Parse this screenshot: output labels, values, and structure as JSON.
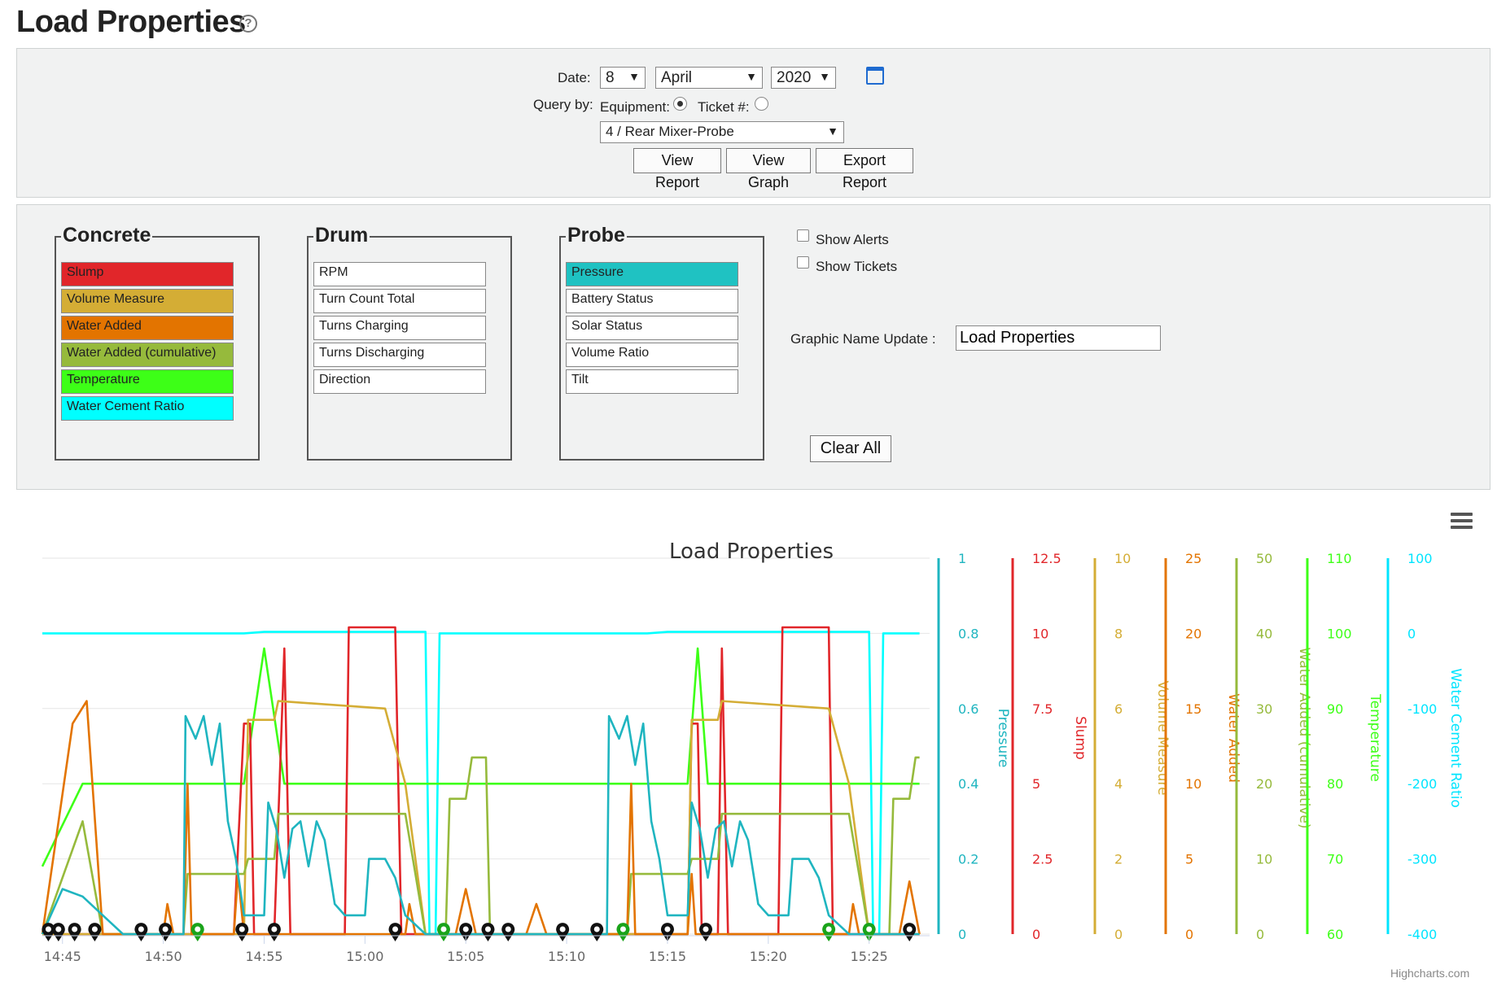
{
  "page": {
    "title": "Load Properties",
    "help_icon": "question-circle-icon"
  },
  "query": {
    "date_label": "Date:",
    "day": "8",
    "month": "April",
    "year": "2020",
    "calendar_icon": "calendar-icon",
    "query_by_label": "Query by:",
    "equipment_label": "Equipment:",
    "ticket_label": "Ticket #:",
    "equipment_selected": true,
    "equipment_value": "4 / Rear Mixer-Probe",
    "buttons": {
      "view_report": "View Report",
      "view_graph": "View Graph",
      "export_report": "Export Report"
    }
  },
  "groups": {
    "concrete": {
      "title": "Concrete",
      "items": [
        {
          "label": "Slump",
          "color": "#e1262a"
        },
        {
          "label": "Volume Measure",
          "color": "#d4ad35"
        },
        {
          "label": "Water Added",
          "color": "#e37400"
        },
        {
          "label": "Water Added (cumulative)",
          "color": "#96ba3c"
        },
        {
          "label": "Temperature",
          "color": "#3dff17"
        },
        {
          "label": "Water Cement Ratio",
          "color": "#00ffff"
        }
      ]
    },
    "drum": {
      "title": "Drum",
      "items": [
        {
          "label": "RPM"
        },
        {
          "label": "Turn Count Total"
        },
        {
          "label": "Turns Charging"
        },
        {
          "label": "Turns Discharging"
        },
        {
          "label": "Direction"
        }
      ]
    },
    "probe": {
      "title": "Probe",
      "items": [
        {
          "label": "Pressure",
          "color": "#1fc2c2"
        },
        {
          "label": "Battery Status"
        },
        {
          "label": "Solar Status"
        },
        {
          "label": "Volume Ratio"
        },
        {
          "label": "Tilt"
        }
      ]
    }
  },
  "options": {
    "show_alerts": "Show Alerts",
    "show_tickets": "Show Tickets",
    "graphic_name_label": "Graphic Name Update :",
    "graphic_name_value": "Load Properties",
    "clear_all": "Clear All"
  },
  "chart_data": {
    "type": "line",
    "title": "Load Properties",
    "x_ticks": [
      "14:45",
      "14:50",
      "14:55",
      "15:00",
      "15:05",
      "15:10",
      "15:15",
      "15:20",
      "15:25"
    ],
    "x_range": [
      "14:44",
      "15:28"
    ],
    "grid": true,
    "credit": "Highcharts.com",
    "menu_icon": "hamburger-menu-icon",
    "y_axes": [
      {
        "title": "Pressure",
        "color": "#1fb5c0",
        "range": [
          0,
          1
        ],
        "ticks": [
          "0",
          "0.2",
          "0.4",
          "0.6",
          "0.8",
          "1"
        ]
      },
      {
        "title": "Slump",
        "color": "#e1262a",
        "range": [
          0,
          12.5
        ],
        "ticks": [
          "0",
          "2.5",
          "5",
          "7.5",
          "10",
          "12.5"
        ]
      },
      {
        "title": "Volume Measure",
        "color": "#d4ad35",
        "range": [
          0,
          10
        ],
        "ticks": [
          "0",
          "2",
          "4",
          "6",
          "8",
          "10"
        ]
      },
      {
        "title": "Water Added",
        "color": "#e37400",
        "range": [
          0,
          25
        ],
        "ticks": [
          "0",
          "5",
          "10",
          "15",
          "20",
          "25"
        ]
      },
      {
        "title": "Water Added (cumulative)",
        "color": "#96ba3c",
        "range": [
          0,
          50
        ],
        "ticks": [
          "0",
          "10",
          "20",
          "30",
          "40",
          "50"
        ]
      },
      {
        "title": "Temperature",
        "color": "#3dff17",
        "range": [
          60,
          110
        ],
        "ticks": [
          "60",
          "70",
          "80",
          "90",
          "100",
          "110"
        ]
      },
      {
        "title": "Water Cement Ratio",
        "color": "#00e5ff",
        "range": [
          -400,
          100
        ],
        "ticks": [
          "-400",
          "-300",
          "-200",
          "-100",
          "0",
          "100"
        ]
      }
    ],
    "series": [
      {
        "name": "Water Cement Ratio",
        "color": "#00ffff",
        "axis": 6,
        "points": [
          [
            "14:44",
            0
          ],
          [
            "14:54",
            0
          ],
          [
            "14:55",
            2
          ],
          [
            "15:03",
            2
          ],
          [
            "15:03.2",
            -400
          ],
          [
            "15:03.5",
            -400
          ],
          [
            "15:03.7",
            0
          ],
          [
            "15:14",
            0
          ],
          [
            "15:15",
            2
          ],
          [
            "15:25",
            2
          ],
          [
            "15:25.2",
            -400
          ],
          [
            "15:25.5",
            -400
          ],
          [
            "15:25.7",
            0
          ],
          [
            "15:27.5",
            0
          ]
        ]
      },
      {
        "name": "Temperature",
        "color": "#3dff17",
        "axis": 5,
        "points": [
          [
            "14:44",
            69
          ],
          [
            "14:46",
            80
          ],
          [
            "14:54",
            80
          ],
          [
            "14:55",
            98
          ],
          [
            "14:56",
            80
          ],
          [
            "15:16",
            80
          ],
          [
            "15:16.5",
            98
          ],
          [
            "15:17",
            80
          ],
          [
            "15:27.5",
            80
          ]
        ]
      },
      {
        "name": "Slump",
        "color": "#e1262a",
        "axis": 1,
        "points": [
          [
            "14:44",
            0
          ],
          [
            "14:53.5",
            0
          ],
          [
            "14:54",
            7
          ],
          [
            "14:54.3",
            7
          ],
          [
            "14:54.5",
            0
          ],
          [
            "14:55.5",
            0
          ],
          [
            "14:56",
            9.5
          ],
          [
            "14:56.3",
            0
          ],
          [
            "14:59",
            0
          ],
          [
            "14:59.2",
            10.2
          ],
          [
            "15:01.5",
            10.2
          ],
          [
            "15:01.8",
            0
          ],
          [
            "15:16",
            0
          ],
          [
            "15:16.2",
            7
          ],
          [
            "15:16.5",
            7
          ],
          [
            "15:16.7",
            0
          ],
          [
            "15:17.5",
            0
          ],
          [
            "15:17.7",
            9.5
          ],
          [
            "15:18",
            0
          ],
          [
            "15:20.5",
            0
          ],
          [
            "15:20.7",
            10.2
          ],
          [
            "15:23",
            10.2
          ],
          [
            "15:23.2",
            0
          ],
          [
            "15:27.5",
            0
          ]
        ]
      },
      {
        "name": "Volume Measure",
        "color": "#d4ad35",
        "axis": 2,
        "points": [
          [
            "14:44",
            0
          ],
          [
            "14:54",
            0
          ],
          [
            "14:54.2",
            5.7
          ],
          [
            "14:55.5",
            5.7
          ],
          [
            "14:55.7",
            6.2
          ],
          [
            "15:01",
            6
          ],
          [
            "15:02",
            4
          ],
          [
            "15:03",
            0
          ],
          [
            "15:16",
            0
          ],
          [
            "15:16.2",
            5.7
          ],
          [
            "15:17.5",
            5.7
          ],
          [
            "15:17.7",
            6.2
          ],
          [
            "15:23",
            6
          ],
          [
            "15:24",
            4
          ],
          [
            "15:25",
            0
          ],
          [
            "15:27.5",
            0
          ]
        ]
      },
      {
        "name": "Water Added (cumulative)",
        "color": "#96ba3c",
        "axis": 4,
        "points": [
          [
            "14:44",
            0
          ],
          [
            "14:46",
            15
          ],
          [
            "14:47",
            0
          ],
          [
            "14:51",
            0
          ],
          [
            "14:51.2",
            8
          ],
          [
            "14:54",
            8
          ],
          [
            "14:54.2",
            10
          ],
          [
            "14:55.5",
            10
          ],
          [
            "14:55.7",
            16
          ],
          [
            "15:02",
            16
          ],
          [
            "15:03",
            0
          ],
          [
            "15:04",
            0
          ],
          [
            "15:04.2",
            18
          ],
          [
            "15:05",
            18
          ],
          [
            "15:05.3",
            23.5
          ],
          [
            "15:06",
            23.5
          ],
          [
            "15:06.2",
            0
          ],
          [
            "15:13",
            0
          ],
          [
            "15:13.2",
            8
          ],
          [
            "15:16",
            8
          ],
          [
            "15:16.2",
            10
          ],
          [
            "15:17.5",
            10
          ],
          [
            "15:17.7",
            16
          ],
          [
            "15:24",
            16
          ],
          [
            "15:25",
            0
          ],
          [
            "15:26",
            0
          ],
          [
            "15:26.2",
            18
          ],
          [
            "15:27",
            18
          ],
          [
            "15:27.3",
            23.5
          ],
          [
            "15:27.5",
            23.5
          ]
        ]
      },
      {
        "name": "Water Added",
        "color": "#e37400",
        "axis": 3,
        "points": [
          [
            "14:44",
            0
          ],
          [
            "14:45.5",
            14
          ],
          [
            "14:46.2",
            15.5
          ],
          [
            "14:47",
            0
          ],
          [
            "14:50",
            0
          ],
          [
            "14:50.2",
            2
          ],
          [
            "14:50.5",
            0
          ],
          [
            "14:51",
            0
          ],
          [
            "14:51.2",
            10
          ],
          [
            "14:51.4",
            0
          ],
          [
            "14:53.5",
            0
          ],
          [
            "14:53.7",
            4
          ],
          [
            "14:54",
            0
          ],
          [
            "15:02",
            0
          ],
          [
            "15:02.2",
            2
          ],
          [
            "15:02.5",
            0
          ],
          [
            "15:04.5",
            0
          ],
          [
            "15:05",
            3
          ],
          [
            "15:05.5",
            0
          ],
          [
            "15:08",
            0
          ],
          [
            "15:08.5",
            2
          ],
          [
            "15:09",
            0
          ],
          [
            "15:13",
            0
          ],
          [
            "15:13.2",
            10
          ],
          [
            "15:13.4",
            0
          ],
          [
            "15:16",
            0
          ],
          [
            "15:16.2",
            4
          ],
          [
            "15:16.4",
            0
          ],
          [
            "15:24",
            0
          ],
          [
            "15:24.2",
            2
          ],
          [
            "15:24.5",
            0
          ],
          [
            "15:26.5",
            0
          ],
          [
            "15:27",
            3.5
          ],
          [
            "15:27.5",
            0
          ]
        ]
      },
      {
        "name": "Pressure",
        "color": "#1fb5c0",
        "axis": 0,
        "points": [
          [
            "14:44",
            0
          ],
          [
            "14:45",
            0.12
          ],
          [
            "14:46",
            0.1
          ],
          [
            "14:47",
            0.05
          ],
          [
            "14:48",
            0
          ],
          [
            "14:51",
            0
          ],
          [
            "14:51.1",
            0.58
          ],
          [
            "14:51.6",
            0.52
          ],
          [
            "14:52",
            0.58
          ],
          [
            "14:52.4",
            0.45
          ],
          [
            "14:52.8",
            0.56
          ],
          [
            "14:53.2",
            0.3
          ],
          [
            "14:53.6",
            0.2
          ],
          [
            "14:54",
            0.05
          ],
          [
            "14:55",
            0.05
          ],
          [
            "14:55.2",
            0.35
          ],
          [
            "14:55.6",
            0.28
          ],
          [
            "14:56",
            0.15
          ],
          [
            "14:56.4",
            0.28
          ],
          [
            "14:56.8",
            0.3
          ],
          [
            "14:57.2",
            0.18
          ],
          [
            "14:57.6",
            0.3
          ],
          [
            "14:58",
            0.25
          ],
          [
            "14:58.5",
            0.08
          ],
          [
            "14:59",
            0.05
          ],
          [
            "15:00",
            0.05
          ],
          [
            "15:00.2",
            0.2
          ],
          [
            "15:01",
            0.2
          ],
          [
            "15:01.5",
            0.15
          ],
          [
            "15:02",
            0.05
          ],
          [
            "15:03",
            0
          ],
          [
            "15:12",
            0
          ],
          [
            "15:12.1",
            0.58
          ],
          [
            "15:12.6",
            0.52
          ],
          [
            "15:13",
            0.58
          ],
          [
            "15:13.4",
            0.45
          ],
          [
            "15:13.8",
            0.56
          ],
          [
            "15:14.2",
            0.3
          ],
          [
            "15:14.6",
            0.2
          ],
          [
            "15:15",
            0.05
          ],
          [
            "15:16",
            0.05
          ],
          [
            "15:16.2",
            0.35
          ],
          [
            "15:16.6",
            0.28
          ],
          [
            "15:17",
            0.15
          ],
          [
            "15:17.4",
            0.28
          ],
          [
            "15:17.8",
            0.3
          ],
          [
            "15:18.2",
            0.18
          ],
          [
            "15:18.6",
            0.3
          ],
          [
            "15:19",
            0.25
          ],
          [
            "15:19.5",
            0.08
          ],
          [
            "15:20",
            0.05
          ],
          [
            "15:21",
            0.05
          ],
          [
            "15:21.2",
            0.2
          ],
          [
            "15:22",
            0.2
          ],
          [
            "15:22.5",
            0.15
          ],
          [
            "15:23",
            0.05
          ],
          [
            "15:24",
            0
          ],
          [
            "15:27.5",
            0
          ]
        ]
      }
    ],
    "markers": [
      {
        "time": "14:44.3",
        "color": "black"
      },
      {
        "time": "14:44.8",
        "color": "black"
      },
      {
        "time": "14:45.6",
        "color": "black"
      },
      {
        "time": "14:46.6",
        "color": "black"
      },
      {
        "time": "14:48.9",
        "color": "black"
      },
      {
        "time": "14:50.1",
        "color": "black"
      },
      {
        "time": "14:51.7",
        "color": "green"
      },
      {
        "time": "14:53.9",
        "color": "black"
      },
      {
        "time": "14:55.5",
        "color": "black"
      },
      {
        "time": "15:01.5",
        "color": "black"
      },
      {
        "time": "15:03.9",
        "color": "green"
      },
      {
        "time": "15:05.0",
        "color": "black"
      },
      {
        "time": "15:06.1",
        "color": "black"
      },
      {
        "time": "15:07.1",
        "color": "black"
      },
      {
        "time": "15:09.8",
        "color": "black"
      },
      {
        "time": "15:11.5",
        "color": "black"
      },
      {
        "time": "15:12.8",
        "color": "green"
      },
      {
        "time": "15:15.0",
        "color": "black"
      },
      {
        "time": "15:16.9",
        "color": "black"
      },
      {
        "time": "15:23.0",
        "color": "green"
      },
      {
        "time": "15:25.0",
        "color": "green"
      },
      {
        "time": "15:27.0",
        "color": "black"
      }
    ]
  }
}
